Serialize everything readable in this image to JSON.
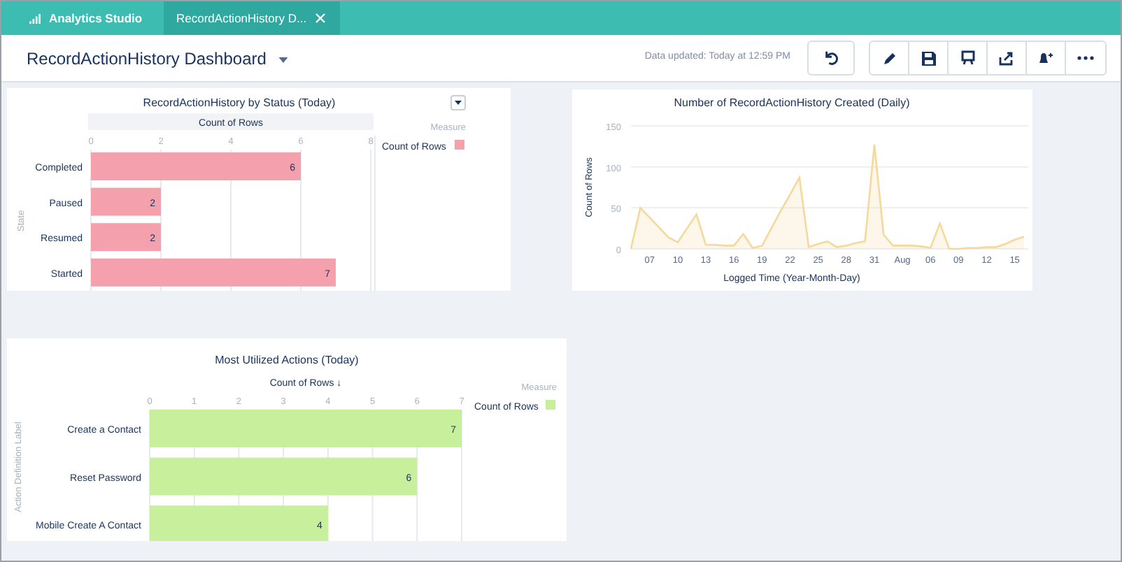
{
  "tabs": [
    {
      "label": "Analytics Studio",
      "selected": false,
      "kind": "home"
    },
    {
      "label": "RecordActionHistory D...",
      "selected": true,
      "kind": "document"
    }
  ],
  "header": {
    "title": "RecordActionHistory Dashboard",
    "data_updated": "Data updated: Today at 12:59 PM"
  },
  "widgets": [
    {
      "legend": {
        "title": "Measure"
      },
      "chart_data": {
        "type": "bar",
        "orientation": "horizontal",
        "title": "RecordActionHistory by Status (Today)",
        "xlabel": "Count of Rows",
        "ylabel": "State",
        "categories": [
          "Completed",
          "Paused",
          "Resumed",
          "Started"
        ],
        "series": [
          {
            "name": "Count of Rows",
            "color": "#f4a0ad",
            "values": [
              6,
              2,
              2,
              7
            ]
          }
        ],
        "xlim": [
          0,
          8
        ],
        "xticks": [
          0,
          2,
          4,
          6,
          8
        ],
        "grid": true,
        "data_labels": true
      }
    },
    {
      "chart_data": {
        "type": "area",
        "title": "Number of RecordActionHistory Created (Daily)",
        "xlabel": "Logged Time (Year-Month-Day)",
        "ylabel": "Count of Rows",
        "categories": [
          null,
          null,
          "07",
          null,
          null,
          "10",
          null,
          null,
          "13",
          null,
          null,
          "16",
          null,
          null,
          "19",
          null,
          null,
          "22",
          null,
          null,
          "25",
          null,
          null,
          "28",
          null,
          null,
          "31",
          null,
          null,
          "Aug",
          null,
          null,
          "06",
          null,
          null,
          "09",
          null,
          null,
          "12",
          null,
          null,
          "15",
          null
        ],
        "series": [
          {
            "color": "#f5d99a",
            "values": [
              0,
              50,
              38,
              26,
              14,
              8,
              25,
              42,
              5,
              5,
              4,
              4,
              18,
              1,
              4,
              25,
              46,
              66,
              87,
              2,
              6,
              9,
              2,
              4,
              7,
              9,
              127,
              17,
              4,
              4,
              4,
              3,
              1,
              31,
              0,
              0,
              1,
              1,
              2,
              2,
              6,
              11,
              15
            ]
          }
        ],
        "ylim": [
          0,
          150
        ],
        "yticks": [
          0,
          50,
          100,
          150
        ],
        "grid": true
      }
    },
    {
      "legend": {
        "title": "Measure"
      },
      "chart_data": {
        "type": "bar",
        "orientation": "horizontal",
        "title": "Most Utilized Actions (Today)",
        "xlabel": "Count of Rows ↓",
        "ylabel": "Action Definition Label",
        "categories": [
          "Create a Contact",
          "Reset Password",
          "Mobile Create A Contact"
        ],
        "series": [
          {
            "name": "Count of Rows",
            "color": "#c8ef9c",
            "values": [
              7,
              6,
              4
            ]
          }
        ],
        "xlim": [
          0,
          7
        ],
        "xticks": [
          0,
          1,
          2,
          3,
          4,
          5,
          6,
          7
        ],
        "grid": true,
        "data_labels": true
      }
    }
  ]
}
